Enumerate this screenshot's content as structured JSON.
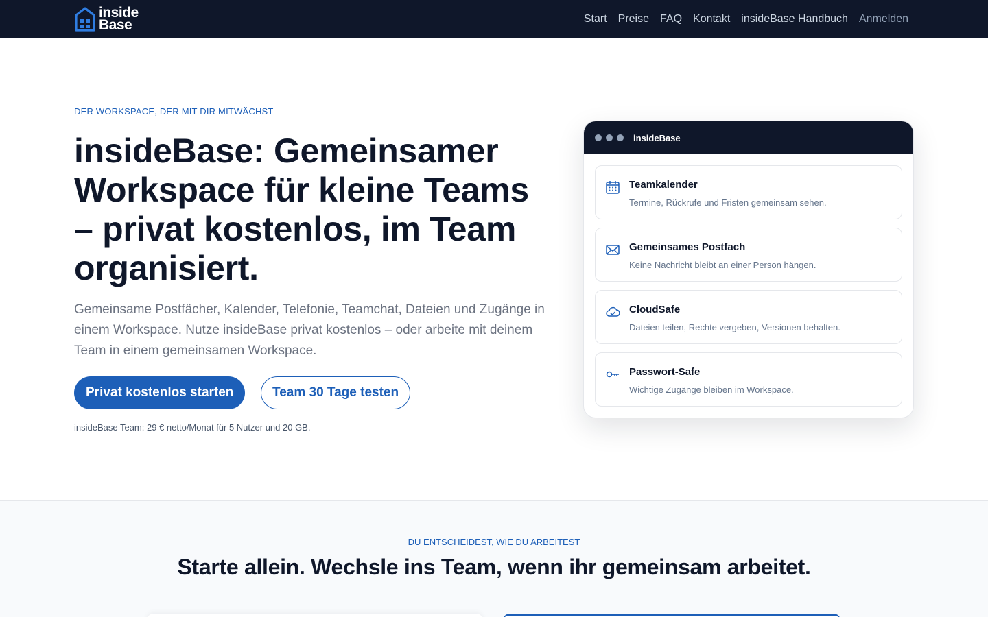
{
  "nav": {
    "logo_line1": "inside",
    "logo_line2": "Base",
    "links": [
      "Start",
      "Preise",
      "FAQ",
      "Kontakt",
      "insideBase Handbuch",
      "Anmelden"
    ]
  },
  "hero": {
    "eyebrow": "DER WORKSPACE, DER MIT DIR MITWÄCHST",
    "title": "insideBase: Gemeinsamer Workspace für kleine Teams – privat kostenlos, im Team organisiert.",
    "description": "Gemeinsame Postfächer, Kalender, Telefonie, Teamchat, Dateien und Zugänge in einem Workspace. Nutze insideBase privat kostenlos – oder arbeite mit deinem Team in einem gemeinsamen Workspace.",
    "primary_button": "Privat kostenlos starten",
    "secondary_button": "Team 30 Tage testen",
    "price_note": "insideBase Team: 29 € netto/Monat für 5 Nutzer und 20 GB."
  },
  "app_card": {
    "title": "insideBase",
    "features": [
      {
        "icon": "calendar-icon",
        "title": "Teamkalender",
        "desc": "Termine, Rückrufe und Fristen gemeinsam sehen."
      },
      {
        "icon": "mail-icon",
        "title": "Gemeinsames Postfach",
        "desc": "Keine Nachricht bleibt an einer Person hängen."
      },
      {
        "icon": "cloud-icon",
        "title": "CloudSafe",
        "desc": "Dateien teilen, Rechte vergeben, Versionen behalten."
      },
      {
        "icon": "key-icon",
        "title": "Passwort-Safe",
        "desc": "Wichtige Zugänge bleiben im Workspace."
      }
    ]
  },
  "section2": {
    "eyebrow": "DU ENTSCHEIDEST, WIE DU ARBEITEST",
    "title": "Starte allein. Wechsle ins Team, wenn ihr gemeinsam arbeitet."
  },
  "colors": {
    "nav_bg": "#0f172a",
    "accent": "#1d5fb8",
    "section_bg": "#f8fafc"
  }
}
